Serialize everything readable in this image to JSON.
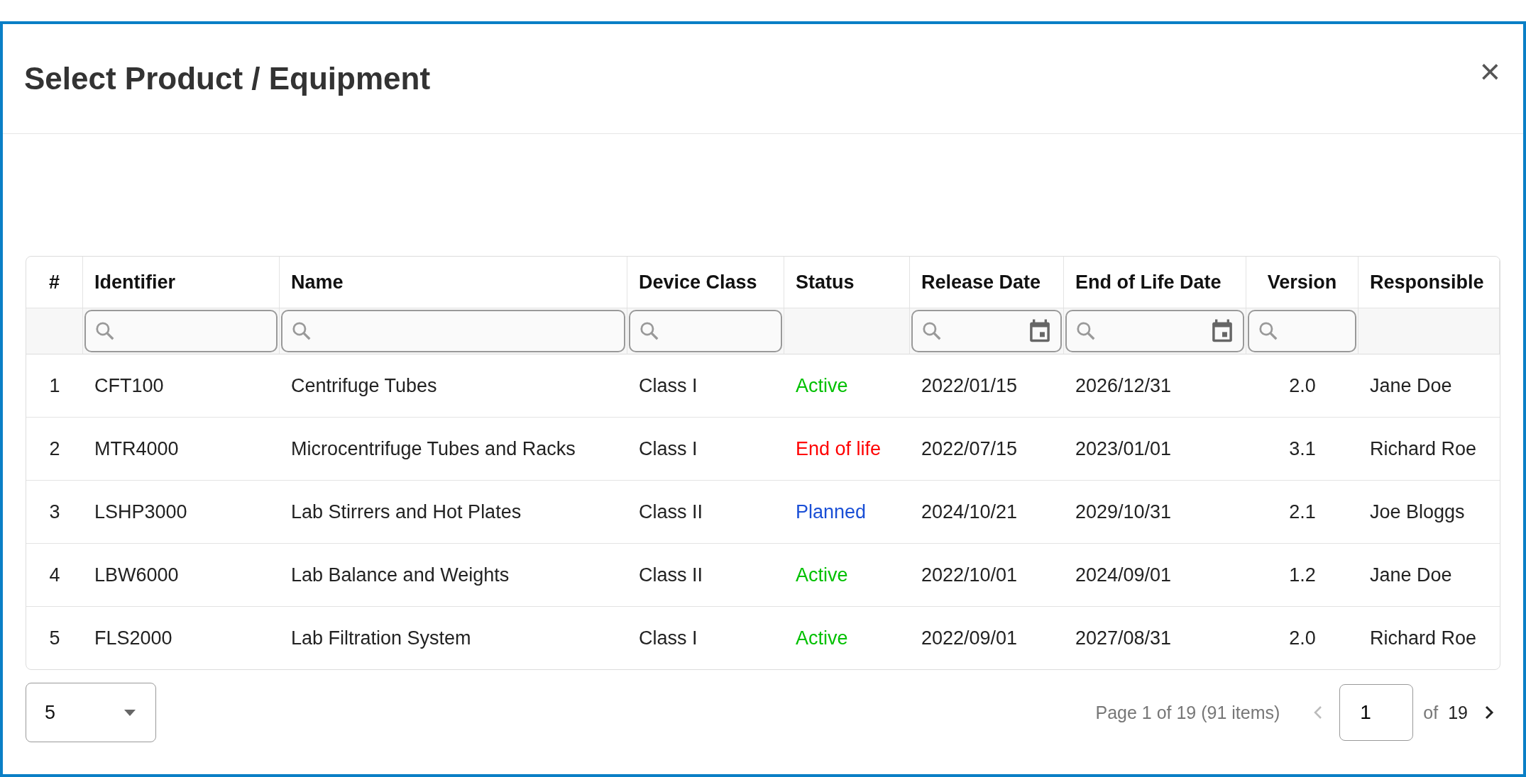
{
  "dialog": {
    "title": "Select Product / Equipment",
    "close": "×"
  },
  "table": {
    "columns": [
      {
        "label": "#",
        "has_filter": false,
        "centered": true
      },
      {
        "label": "Identifier",
        "has_filter": true,
        "centered": false
      },
      {
        "label": "Name",
        "has_filter": true,
        "centered": false
      },
      {
        "label": "Device Class",
        "has_filter": true,
        "centered": false
      },
      {
        "label": "Status",
        "has_filter": false,
        "centered": false
      },
      {
        "label": "Release Date",
        "has_filter": true,
        "date_picker": true,
        "centered": false
      },
      {
        "label": "End of Life Date",
        "has_filter": true,
        "date_picker": true,
        "centered": false
      },
      {
        "label": "Version",
        "has_filter": true,
        "centered": true
      },
      {
        "label": "Responsible",
        "has_filter": false,
        "centered": false
      }
    ],
    "rows": [
      {
        "cells": [
          "1",
          "CFT100",
          "Centrifuge Tubes",
          "Class I",
          "Active",
          "2022/01/15",
          "2026/12/31",
          "2.0",
          "Jane Doe"
        ],
        "color": "#00c000"
      },
      {
        "cells": [
          "2",
          "MTR4000",
          "Microcentrifuge Tubes and Racks",
          "Class I",
          "End of life",
          "2022/07/15",
          "2023/01/01",
          "3.1",
          "Richard Roe"
        ],
        "color": "#ff0000"
      },
      {
        "cells": [
          "3",
          "LSHP3000",
          "Lab Stirrers and Hot Plates",
          "Class II",
          "Planned",
          "2024/10/21",
          "2029/10/31",
          "2.1",
          "Joe Bloggs"
        ],
        "color": "#1a4fd6"
      },
      {
        "cells": [
          "4",
          "LBW6000",
          "Lab Balance and Weights",
          "Class II",
          "Active",
          "2022/10/01",
          "2024/09/01",
          "1.2",
          "Jane Doe"
        ],
        "color": "#00c000"
      },
      {
        "cells": [
          "5",
          "FLS2000",
          "Lab Filtration System",
          "Class I",
          "Active",
          "2022/09/01",
          "2027/08/31",
          "2.0",
          "Richard Roe"
        ],
        "color": "#00c000"
      }
    ]
  },
  "pager": {
    "page_size": "5",
    "summary": "Page 1 of 19 (91 items)",
    "page": "1",
    "of_label": "of",
    "total_pages": "19",
    "prev_disabled": true,
    "next_disabled": false
  }
}
